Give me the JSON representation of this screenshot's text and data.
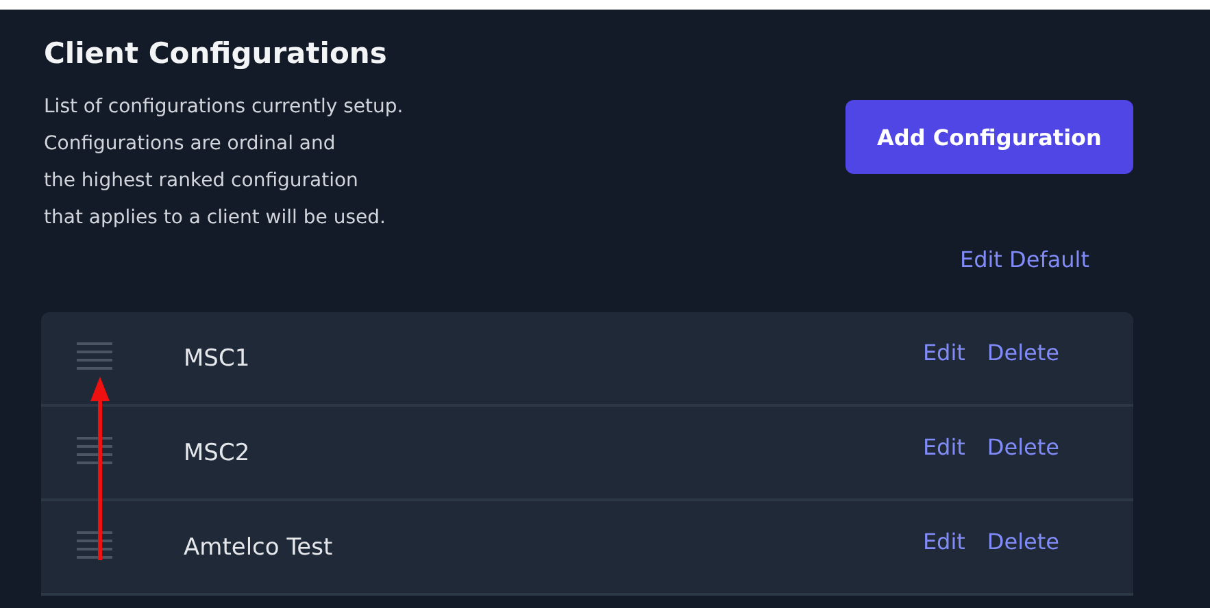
{
  "title": "Client Configurations",
  "description_lines": [
    "List of configurations currently setup.",
    "Configurations are ordinal and",
    "the highest ranked configuration",
    "that applies to a client will be used."
  ],
  "add_button": "Add Configuration",
  "edit_default": "Edit Default",
  "rows": [
    {
      "name": "MSC1",
      "actions": [
        "Edit",
        "Delete"
      ]
    },
    {
      "name": "MSC2",
      "actions": [
        "Edit",
        "Delete"
      ]
    },
    {
      "name": "Amtelco Test",
      "actions": [
        "Edit",
        "Delete"
      ]
    }
  ],
  "annotation": {
    "kind": "arrow"
  }
}
